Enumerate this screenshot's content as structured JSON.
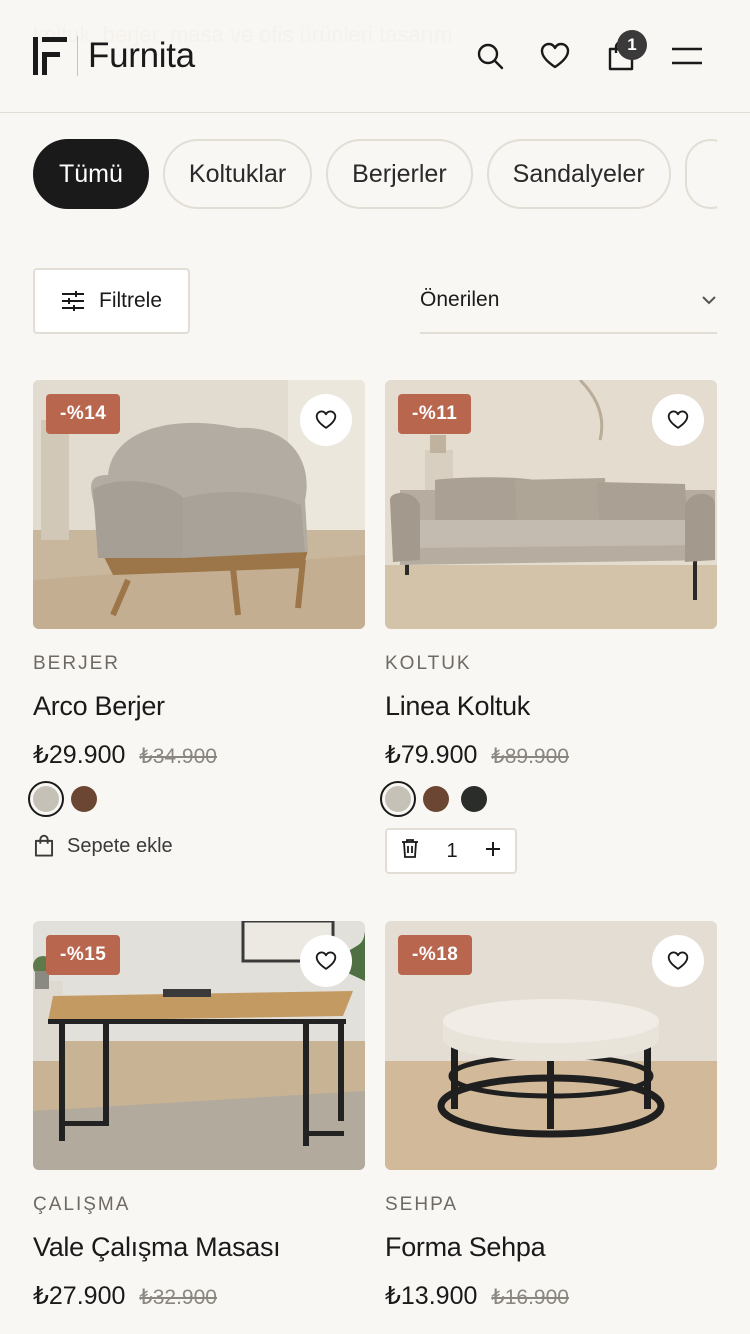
{
  "background_text": "koltuk, berjer, masa ve ofis ürünleri tasarım",
  "brand": {
    "name": "Furnita"
  },
  "cart": {
    "count": "1"
  },
  "categories": [
    "Tümü",
    "Koltuklar",
    "Berjerler",
    "Sandalyeler",
    ""
  ],
  "toolbar": {
    "filter_label": "Filtrele",
    "sort_label": "Önerilen"
  },
  "products": [
    {
      "discount": "-%14",
      "category": "BERJER",
      "name": "Arco Berjer",
      "price": "₺29.900",
      "old_price": "₺34.900",
      "swatches": [
        "#c6c1b6",
        "#6b4632"
      ],
      "selected_swatch": 0,
      "action": "Sepete ekle"
    },
    {
      "discount": "-%11",
      "category": "KOLTUK",
      "name": "Linea Koltuk",
      "price": "₺79.900",
      "old_price": "₺89.900",
      "swatches": [
        "#c6c1b6",
        "#6b4632",
        "#2b2d2a"
      ],
      "selected_swatch": 0,
      "quantity": "1"
    },
    {
      "discount": "-%15",
      "category": "ÇALIŞMA",
      "name": "Vale Çalışma Masası",
      "price": "₺27.900",
      "old_price": "₺32.900"
    },
    {
      "discount": "-%18",
      "category": "SEHPA",
      "name": "Forma Sehpa",
      "price": "₺13.900",
      "old_price": "₺16.900"
    }
  ],
  "colors": {
    "badge": "#b9664f",
    "accent": "#1a1a1a",
    "background": "#f9f7f3"
  }
}
